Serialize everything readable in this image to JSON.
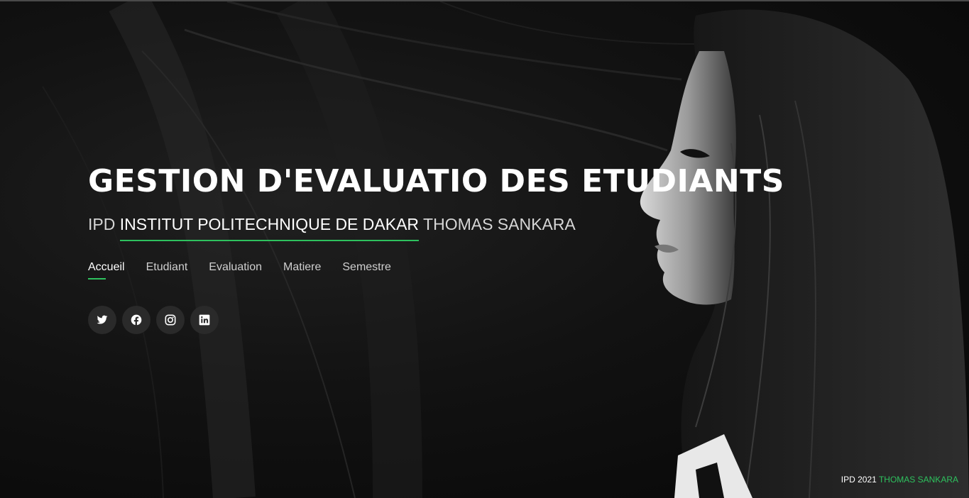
{
  "hero": {
    "title": "GESTION D'EVALUATIO DES ETUDIANTS",
    "subtitle_prefix": "IPD",
    "subtitle_highlight": "INSTITUT POLITECHNIQUE DE DAKAR",
    "subtitle_suffix": "THOMAS SANKARA"
  },
  "nav": {
    "items": [
      {
        "label": "Accueil",
        "active": true
      },
      {
        "label": "Etudiant",
        "active": false
      },
      {
        "label": "Evaluation",
        "active": false
      },
      {
        "label": "Matiere",
        "active": false
      },
      {
        "label": "Semestre",
        "active": false
      }
    ]
  },
  "social": {
    "icons": [
      "twitter-icon",
      "facebook-icon",
      "instagram-icon",
      "linkedin-icon"
    ]
  },
  "footer": {
    "prefix": "IPD 2021",
    "name": "THOMAS SANKARA"
  },
  "colors": {
    "accent": "#2ec15e",
    "background": "#0b0b0b",
    "social_bg": "#2a2a2a"
  }
}
